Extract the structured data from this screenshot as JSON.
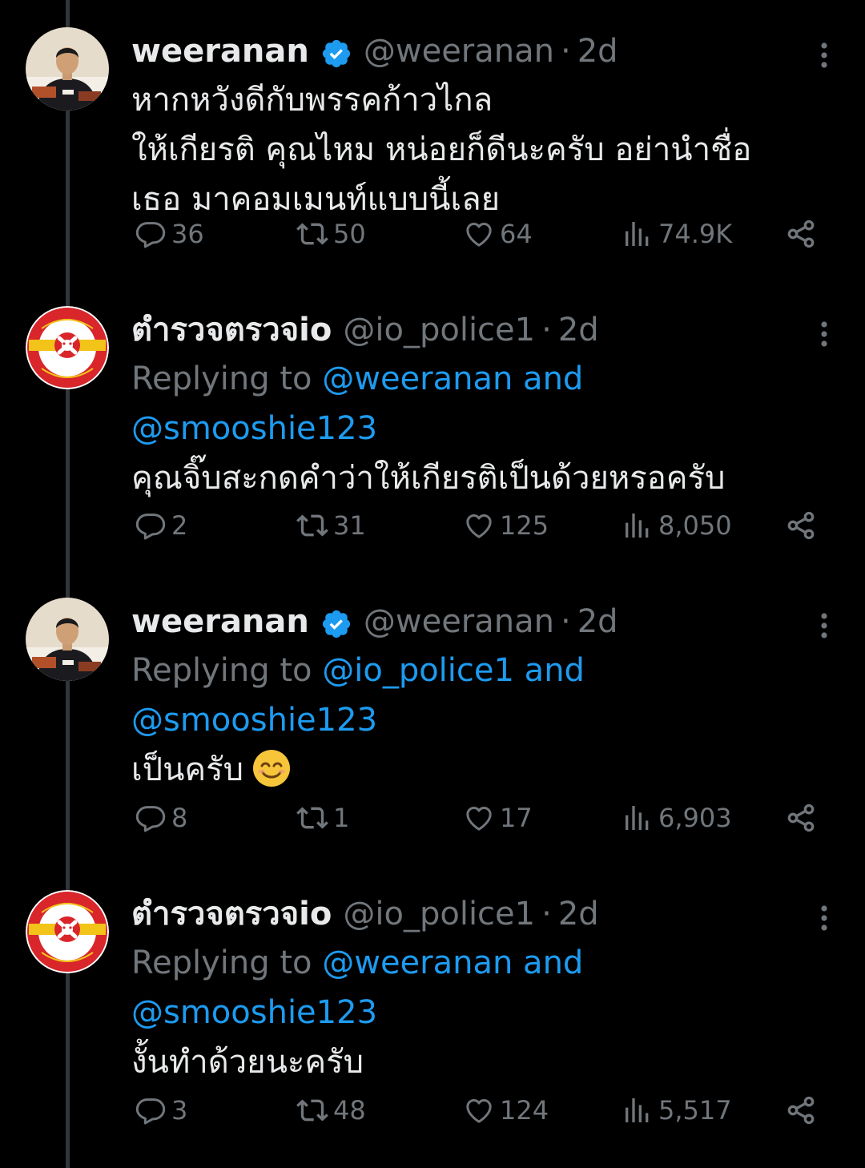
{
  "colors": {
    "background": "#000000",
    "primary_text": "#e7e9ea",
    "secondary_text": "#71767b",
    "link": "#1d9bf0",
    "verified": "#1d9bf0",
    "thread_line": "#333639"
  },
  "tweets": [
    {
      "display_name": "weeranan",
      "verified": true,
      "handle": "@weeranan",
      "separator": "·",
      "time": "2d",
      "replying_prefix": "",
      "replying_mention_1": "",
      "replying_and": "",
      "replying_mention_2": "",
      "text": "หากหวังดีกับพรรคก้าวไกล\nให้เกียรติ คุณไหม หน่อยก็ดีนะครับ อย่านำชื่อ\nเธอ มาคอมเมนท์แบบนี้เลย",
      "emoji": "",
      "replies": "36",
      "retweets": "50",
      "likes": "64",
      "views": "74.9K",
      "avatar_icon": "person-photo"
    },
    {
      "display_name": "ตำรวจตรวจio",
      "verified": false,
      "handle": "@io_police1",
      "separator": "·",
      "time": "2d",
      "replying_prefix": "Replying to ",
      "replying_mention_1": "@weeranan",
      "replying_and": " and",
      "replying_mention_2": "@smooshie123",
      "text": "คุณจิ๊บสะกดคำว่าให้เกียรติเป็นด้วยหรอครับ",
      "emoji": "",
      "replies": "2",
      "retweets": "31",
      "likes": "125",
      "views": "8,050",
      "avatar_icon": "police-badge-logo",
      "logo_text": [
        "ANTI IO POLICE",
        "ตำรวจตรวจไอโอ",
        "อิ่งไย่"
      ]
    },
    {
      "display_name": "weeranan",
      "verified": true,
      "handle": "@weeranan",
      "separator": "·",
      "time": "2d",
      "replying_prefix": "Replying to ",
      "replying_mention_1": "@io_police1",
      "replying_and": " and",
      "replying_mention_2": "@smooshie123",
      "text": "เป็นครับ",
      "emoji": "smiling-face-emoji",
      "replies": "8",
      "retweets": "1",
      "likes": "17",
      "views": "6,903",
      "avatar_icon": "person-photo"
    },
    {
      "display_name": "ตำรวจตรวจio",
      "verified": false,
      "handle": "@io_police1",
      "separator": "·",
      "time": "2d",
      "replying_prefix": "Replying to ",
      "replying_mention_1": "@weeranan",
      "replying_and": " and",
      "replying_mention_2": "@smooshie123",
      "text": "งั้นทำด้วยนะครับ",
      "emoji": "",
      "replies": "3",
      "retweets": "48",
      "likes": "124",
      "views": "5,517",
      "avatar_icon": "police-badge-logo",
      "logo_text": [
        "ANTI IO POLICE",
        "ตำรวจตรวจไอโอ",
        "อิ่งไย่"
      ]
    }
  ]
}
